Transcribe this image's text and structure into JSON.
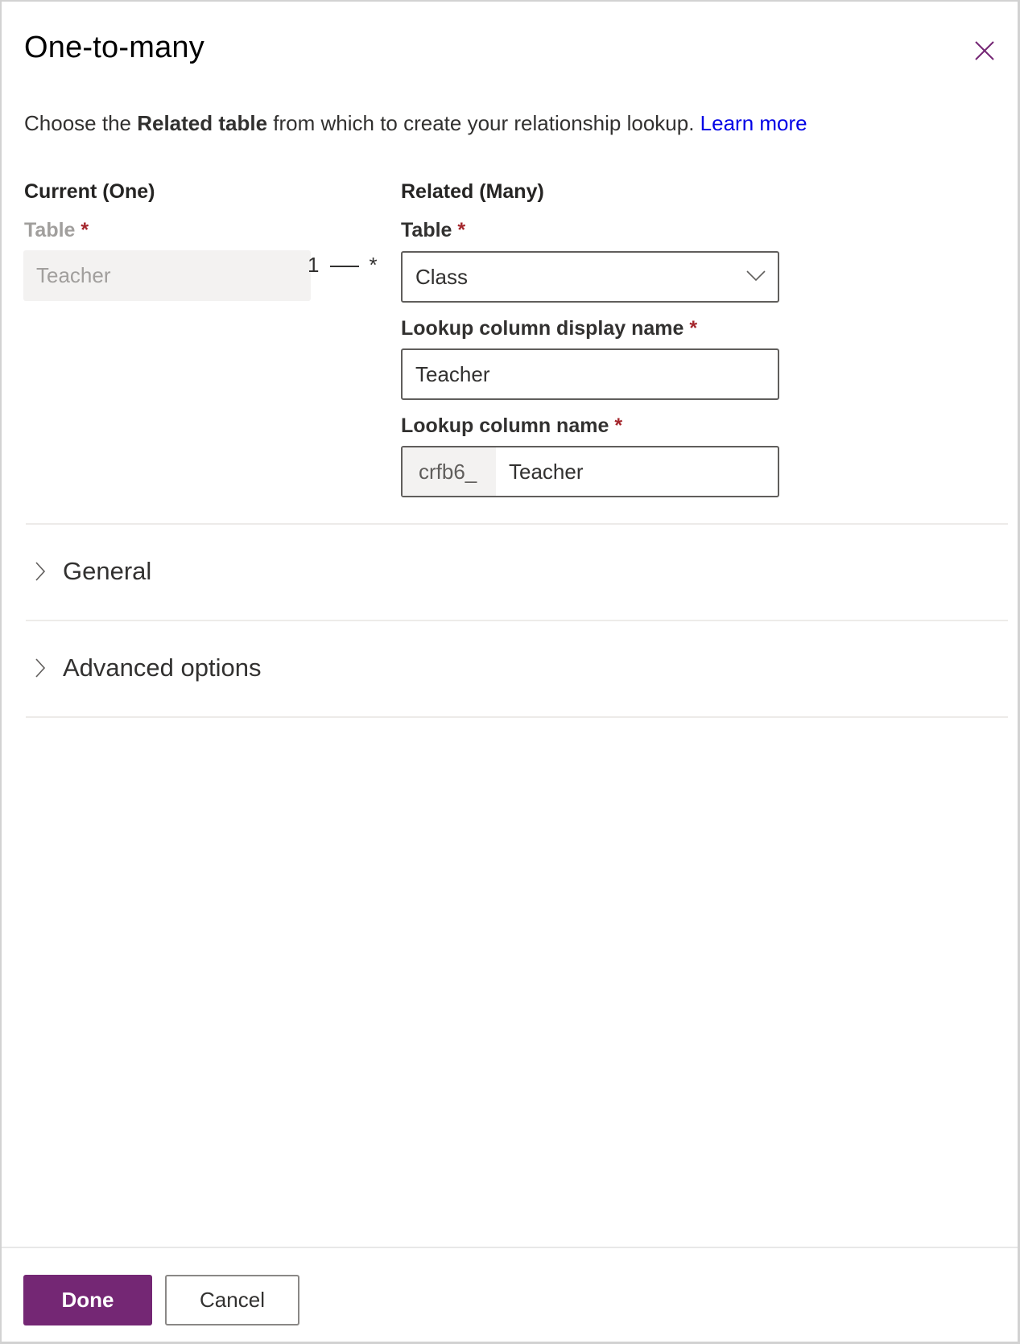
{
  "dialog": {
    "title": "One-to-many",
    "close_icon": "close-icon",
    "description": {
      "prefix": "Choose the ",
      "bold": "Related table",
      "suffix": " from which to create your relationship lookup. ",
      "link": "Learn more"
    }
  },
  "current": {
    "heading": "Current (One)",
    "table_label": "Table",
    "required_mark": "*",
    "table_value": "Teacher"
  },
  "cardinality": {
    "one": "1",
    "many": "*"
  },
  "related": {
    "heading": "Related (Many)",
    "table_label": "Table",
    "table_value": "Class",
    "required_mark": "*",
    "lookup_display_label": "Lookup column display name",
    "lookup_display_value": "Teacher",
    "lookup_name_label": "Lookup column name",
    "lookup_name_prefix": "crfb6_",
    "lookup_name_value": "Teacher"
  },
  "sections": [
    {
      "label": "General",
      "icon": "chevron-right-icon",
      "expanded": false
    },
    {
      "label": "Advanced options",
      "icon": "chevron-right-icon",
      "expanded": false
    }
  ],
  "footer": {
    "done_label": "Done",
    "cancel_label": "Cancel"
  },
  "colors": {
    "accent": "#742774",
    "link": "#0000e6",
    "required": "#a4262c"
  }
}
